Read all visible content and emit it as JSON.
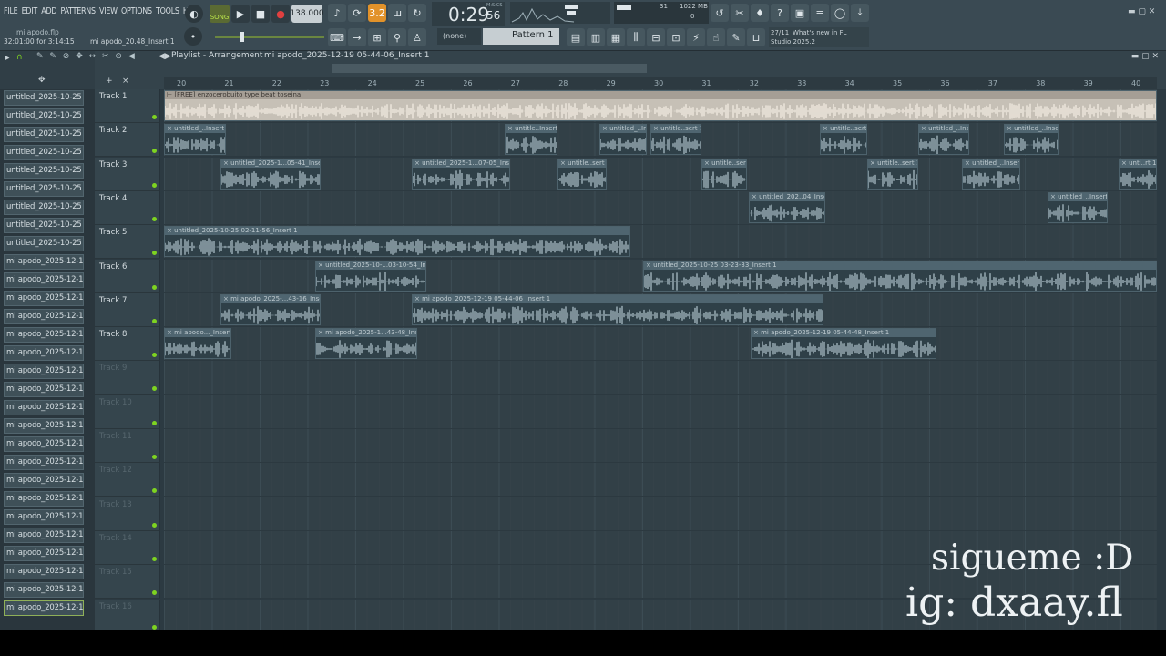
{
  "menu": [
    "FILE",
    "EDIT",
    "ADD",
    "PATTERNS",
    "VIEW",
    "OPTIONS",
    "TOOLS",
    "HELP"
  ],
  "transport": {
    "song_mode": "SONG",
    "tempo": "138.000",
    "time": "0:29",
    "time_small": "56",
    "time_unit": "M:S:CS",
    "pattern": "Pattern 1",
    "none_label": "(none)",
    "snap": "3.2"
  },
  "cpu": {
    "value1": "31",
    "mem": "1022 MB",
    "value2": "0"
  },
  "news": {
    "counter": "27/11",
    "line1": "What's new in FL",
    "line2": "Studio 2025.2"
  },
  "project": {
    "file": "mi apodo.flp",
    "position": "32:01:00 for 3:14:15",
    "insert": "mi apodo_20.48_Insert 1"
  },
  "playlist": {
    "title": "Playlist - Arrangement",
    "breadcrumb": "mi apodo_2025-12-19 05-44-06_Insert 1"
  },
  "ruler": [
    "20",
    "21",
    "22",
    "23",
    "24",
    "25",
    "26",
    "27",
    "28",
    "29",
    "30",
    "31",
    "32",
    "33",
    "34",
    "35",
    "36",
    "37",
    "38",
    "39",
    "40"
  ],
  "browser": [
    "untitled_2025-10-25 03-...",
    "untitled_2025-10-25 03-...",
    "untitled_2025-10-25 03-...",
    "untitled_2025-10-25 03-...",
    "untitled_2025-10-25 03-...",
    "untitled_2025-10-25 03-...",
    "untitled_2025-10-25 03-...",
    "untitled_2025-10-25 03-...",
    "untitled_2025-10-25 03-...",
    "mi apodo_2025-12-17 1...",
    "mi apodo_2025-12-17 1...",
    "mi apodo_2025-12-17 1...",
    "mi apodo_2025-12-17 1...",
    "mi apodo_2025-12-17 1...",
    "mi apodo_2025-12-17 1...",
    "mi apodo_2025-12-17 1...",
    "mi apodo_2025-12-17 1...",
    "mi apodo_2025-12-17 1...",
    "mi apodo_2025-12-17 1...",
    "mi apodo_2025-12-17 1...",
    "mi apodo_2025-12-17 1...",
    "mi apodo_2025-12-17 1...",
    "mi apodo_2025-12-17 1...",
    "mi apodo_2025-12-17 1...",
    "mi apodo_2025-12-17 1...",
    "mi apodo_2025-12-19 0...",
    "mi apodo_2025-12-19 0...",
    "mi apodo_2025-12-19 0...",
    "mi apodo_2025-12-19 0..."
  ],
  "tracks": [
    {
      "name": "Track 1",
      "clips": [
        {
          "label": "[FREE] enzocerobuito  type beat  toseina",
          "big": true
        }
      ]
    },
    {
      "name": "Track 2",
      "clips": [
        {
          "label": "untitled_..Insert 1"
        },
        {
          "label": "untitle..Insert 1"
        },
        {
          "label": "untitled_..Insert 1"
        },
        {
          "label": "untitle..sert 1"
        },
        {
          "label": "untitle..sert 1"
        },
        {
          "label": "untitled_..Insert 1"
        },
        {
          "label": "untitled_..Insert 1"
        }
      ]
    },
    {
      "name": "Track 3",
      "clips": [
        {
          "label": "untitled_2025-1...05-41_Insert 1"
        },
        {
          "label": "untitled_2025-1...07-05_Insert 1"
        },
        {
          "label": "untitle..sert 1"
        },
        {
          "label": "untitle..sert 1"
        },
        {
          "label": "untitle..sert 1"
        },
        {
          "label": "untitled_..Insert 1"
        },
        {
          "label": "unti..rt 1"
        }
      ]
    },
    {
      "name": "Track 4",
      "clips": [
        {
          "label": "untitled_202..04_Insert 1"
        },
        {
          "label": "untitled_..Insert 1"
        }
      ]
    },
    {
      "name": "Track 5",
      "clips": [
        {
          "label": "untitled_2025-10-25 02-11-56_Insert 1"
        }
      ]
    },
    {
      "name": "Track 6",
      "clips": [
        {
          "label": "untitled_2025-10-...03-10-54_Insert 1"
        },
        {
          "label": "untitled_2025-10-25 03-23-33_Insert 1"
        }
      ]
    },
    {
      "name": "Track 7",
      "clips": [
        {
          "label": "mi apodo_2025-...43-16_Insert 1"
        },
        {
          "label": "mi apodo_2025-12-19 05-44-06_Insert 1"
        }
      ]
    },
    {
      "name": "Track 8",
      "clips": [
        {
          "label": "mi apodo..._Insert 1"
        },
        {
          "label": "mi apodo_2025-1...43-48_Insert 1"
        },
        {
          "label": "mi apodo_2025-12-19 05-44-48_Insert 1"
        }
      ]
    },
    {
      "name": "Track 9",
      "clips": []
    },
    {
      "name": "Track 10",
      "clips": []
    },
    {
      "name": "Track 11",
      "clips": []
    },
    {
      "name": "Track 12",
      "clips": []
    },
    {
      "name": "Track 13",
      "clips": []
    },
    {
      "name": "Track 14",
      "clips": []
    },
    {
      "name": "Track 15",
      "clips": []
    },
    {
      "name": "Track 16",
      "clips": []
    }
  ],
  "watermark": {
    "line1": "sigueme :D",
    "line2": "ig: dxaay.fl"
  }
}
